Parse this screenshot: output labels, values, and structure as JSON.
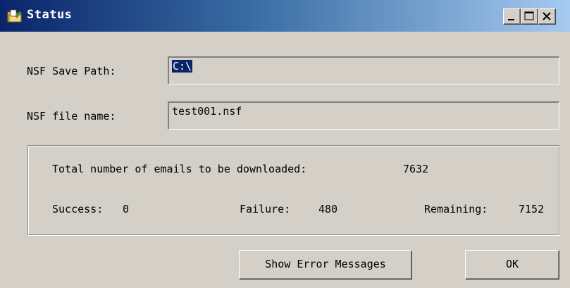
{
  "window": {
    "title": "Status",
    "icon": "folder-app-icon",
    "controls": [
      "minimize-icon",
      "maximize-icon",
      "close-icon"
    ]
  },
  "fields": {
    "save_path_label": "NSF Save Path:",
    "save_path_value": "C:\\",
    "file_name_label": "NSF file name:",
    "file_name_value": "test001.nsf"
  },
  "stats": {
    "total_label": "Total number of emails to be downloaded:",
    "total_value": "7632",
    "success_label": "Success:",
    "success_value": "0",
    "failure_label": "Failure:",
    "failure_value": "480",
    "remaining_label": "Remaining:",
    "remaining_value": "7152"
  },
  "buttons": {
    "show_errors": "Show Error Messages",
    "ok": "OK"
  },
  "colors": {
    "titlebar_start": "#0a246a",
    "titlebar_end": "#a6caf0",
    "face": "#d4d0c8",
    "selection": "#0a246a"
  }
}
